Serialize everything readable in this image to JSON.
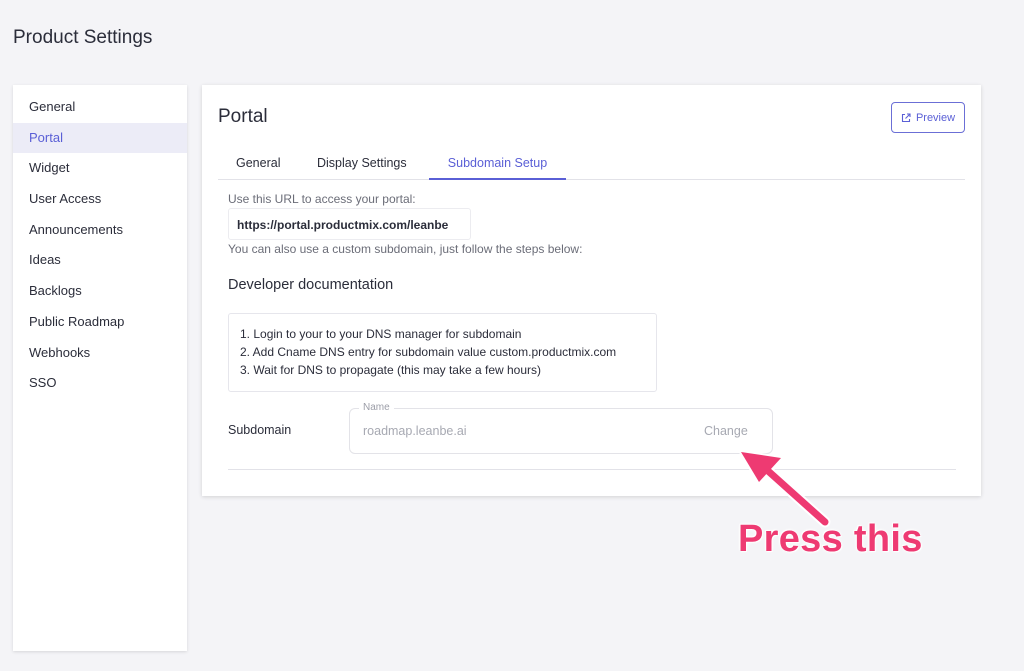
{
  "page_title": "Product Settings",
  "sidebar": {
    "items": [
      {
        "label": "General",
        "active": false
      },
      {
        "label": "Portal",
        "active": true
      },
      {
        "label": "Widget",
        "active": false
      },
      {
        "label": "User Access",
        "active": false
      },
      {
        "label": "Announcements",
        "active": false
      },
      {
        "label": "Ideas",
        "active": false
      },
      {
        "label": "Backlogs",
        "active": false
      },
      {
        "label": "Public Roadmap",
        "active": false
      },
      {
        "label": "Webhooks",
        "active": false
      },
      {
        "label": "SSO",
        "active": false
      }
    ]
  },
  "card": {
    "title": "Portal",
    "preview_label": "Preview",
    "tabs": [
      {
        "label": "General",
        "active": false
      },
      {
        "label": "Display Settings",
        "active": false
      },
      {
        "label": "Subdomain Setup",
        "active": true
      }
    ],
    "url_intro": "Use this URL to access your portal:",
    "portal_url": "https://portal.productmix.com/leanbe",
    "custom_text": "You can also use a custom subdomain, just follow the steps below:",
    "dev_heading": "Developer documentation",
    "steps": [
      "1. Login to your to your DNS manager for subdomain",
      "2. Add Cname DNS entry for subdomain value custom.productmix.com",
      "3. Wait for DNS to propagate (this may take a few hours)"
    ],
    "subdomain_label": "Subdomain",
    "subdomain_field": {
      "label": "Name",
      "value": "roadmap.leanbe.ai",
      "change_label": "Change"
    }
  },
  "annotation": {
    "text": "Press this",
    "color": "#ee3a72"
  },
  "colors": {
    "accent": "#5a5fd6",
    "active_bg": "#ececf7",
    "background": "#f4f4f7"
  }
}
